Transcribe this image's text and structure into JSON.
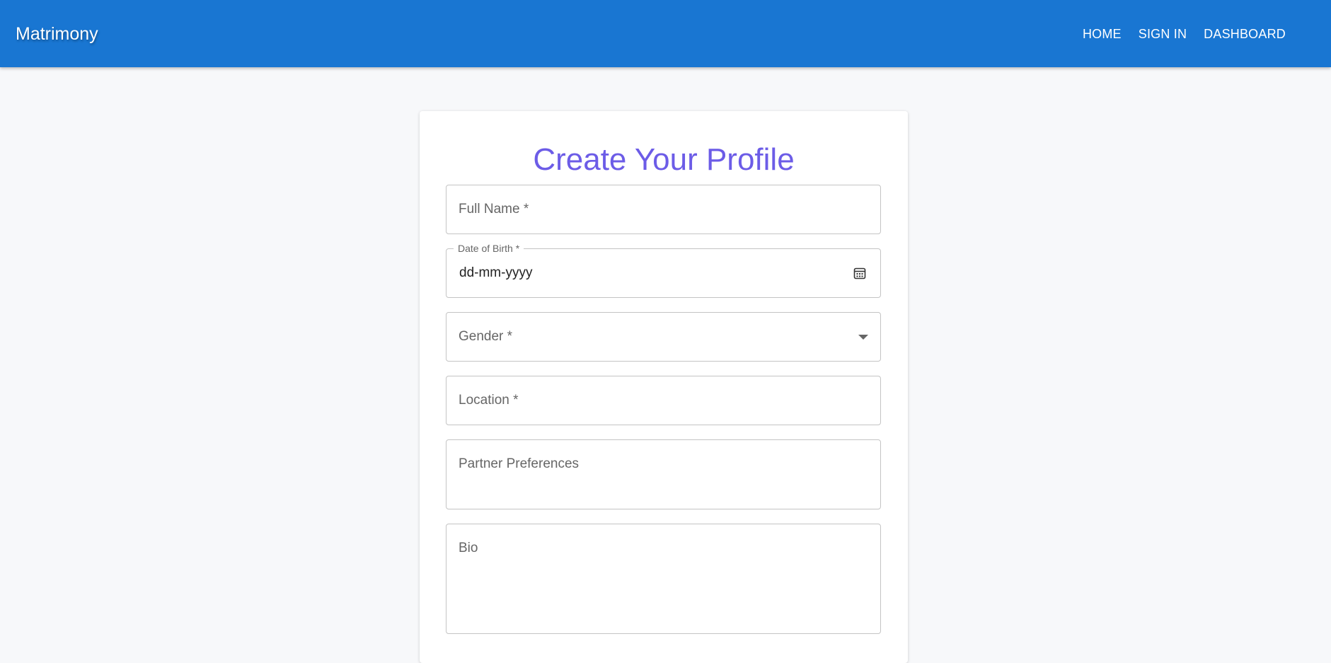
{
  "app": {
    "brand": "Matrimony"
  },
  "nav": {
    "items": [
      {
        "label": "HOME"
      },
      {
        "label": "SIGN IN"
      },
      {
        "label": "DASHBOARD"
      }
    ]
  },
  "form": {
    "title": "Create Your Profile",
    "full_name": {
      "label": "Full Name *"
    },
    "dob": {
      "label": "Date of Birth *",
      "value": "dd-mm-yyyy"
    },
    "gender": {
      "label": "Gender *"
    },
    "location": {
      "label": "Location *"
    },
    "partner_preferences": {
      "label": "Partner Preferences"
    },
    "bio": {
      "label": "Bio"
    }
  },
  "colors": {
    "appbar": "#1976d2",
    "title": "#6c5ce7",
    "page_background": "#f7f8fa"
  },
  "icons": {
    "dob_picker": "calendar-icon",
    "gender_select": "caret-down-icon"
  }
}
